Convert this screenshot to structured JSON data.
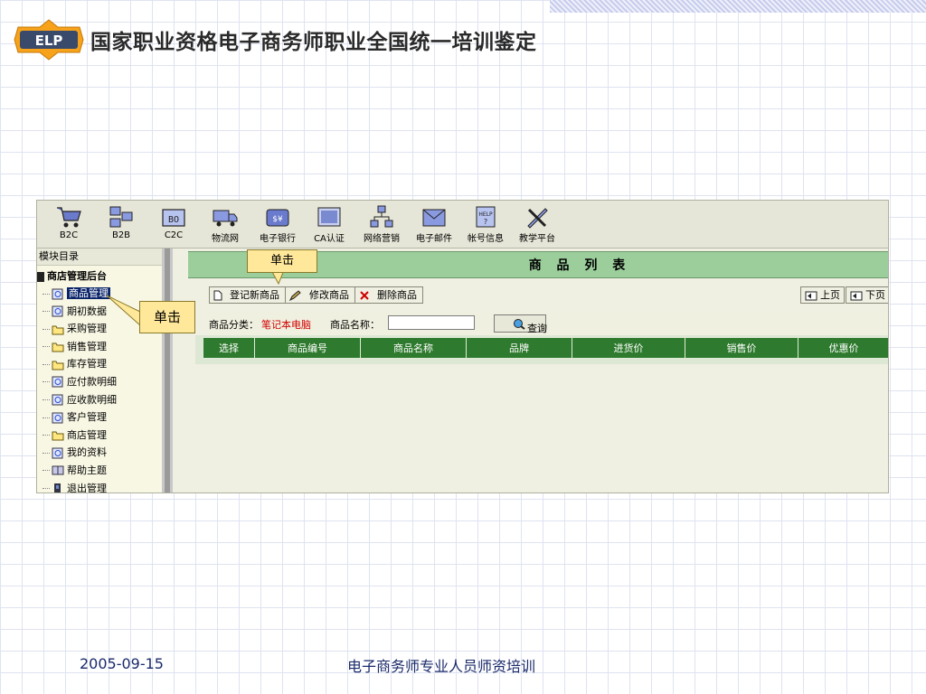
{
  "slide": {
    "logo_text": "ELP",
    "title": "国家职业资格电子商务师职业全国统一培训鉴定",
    "footer_date": "2005-09-15",
    "footer_text": "电子商务师专业人员师资培训"
  },
  "toolbar": {
    "items": [
      {
        "label": "B2C",
        "icon": "cart-icon"
      },
      {
        "label": "B2B",
        "icon": "b2b-network-icon"
      },
      {
        "label": "C2C",
        "icon": "c2c-icon"
      },
      {
        "label": "物流网",
        "icon": "truck-icon"
      },
      {
        "label": "电子银行",
        "icon": "bank-wallet-icon"
      },
      {
        "label": "CA认证",
        "icon": "certificate-icon"
      },
      {
        "label": "网络营销",
        "icon": "network-tree-icon"
      },
      {
        "label": "电子邮件",
        "icon": "email-icon"
      },
      {
        "label": "帐号信息",
        "icon": "help-account-icon"
      },
      {
        "label": "教学平台",
        "icon": "tools-icon"
      }
    ]
  },
  "sidebar": {
    "header": "模块目录",
    "root": "商店管理后台",
    "items": [
      {
        "label": "商品管理",
        "icon": "page-icon",
        "active": true
      },
      {
        "label": "期初数据",
        "icon": "page-icon"
      },
      {
        "label": "采购管理",
        "icon": "folder-icon"
      },
      {
        "label": "销售管理",
        "icon": "folder-icon"
      },
      {
        "label": "库存管理",
        "icon": "folder-icon"
      },
      {
        "label": "应付款明细",
        "icon": "page-icon"
      },
      {
        "label": "应收款明细",
        "icon": "page-icon"
      },
      {
        "label": "客户管理",
        "icon": "page-icon"
      },
      {
        "label": "商店管理",
        "icon": "folder-icon"
      },
      {
        "label": "我的资料",
        "icon": "page-icon"
      },
      {
        "label": "帮助主题",
        "icon": "help-book-icon"
      },
      {
        "label": "退出管理",
        "icon": "exit-icon"
      }
    ]
  },
  "main": {
    "title": "商 品 列 表",
    "actions": {
      "register": "登记新商品",
      "edit": "修改商品",
      "delete": "删除商品"
    },
    "nav": {
      "prev": "上页",
      "next": "下页"
    },
    "search": {
      "category_label": "商品分类：",
      "category_value": "笔记本电脑",
      "name_label": "商品名称：",
      "name_value": "",
      "query_button": "查询"
    },
    "table": {
      "columns": [
        "选择",
        "商品编号",
        "商品名称",
        "品牌",
        "进货价",
        "销售价",
        "优惠价"
      ]
    }
  },
  "callouts": {
    "top": "单击",
    "left": "单击"
  },
  "colors": {
    "header_green": "#9cce9c",
    "table_header": "#2e7a2e",
    "callout_fill": "#ffe89a",
    "highlight": "#0a246a"
  }
}
